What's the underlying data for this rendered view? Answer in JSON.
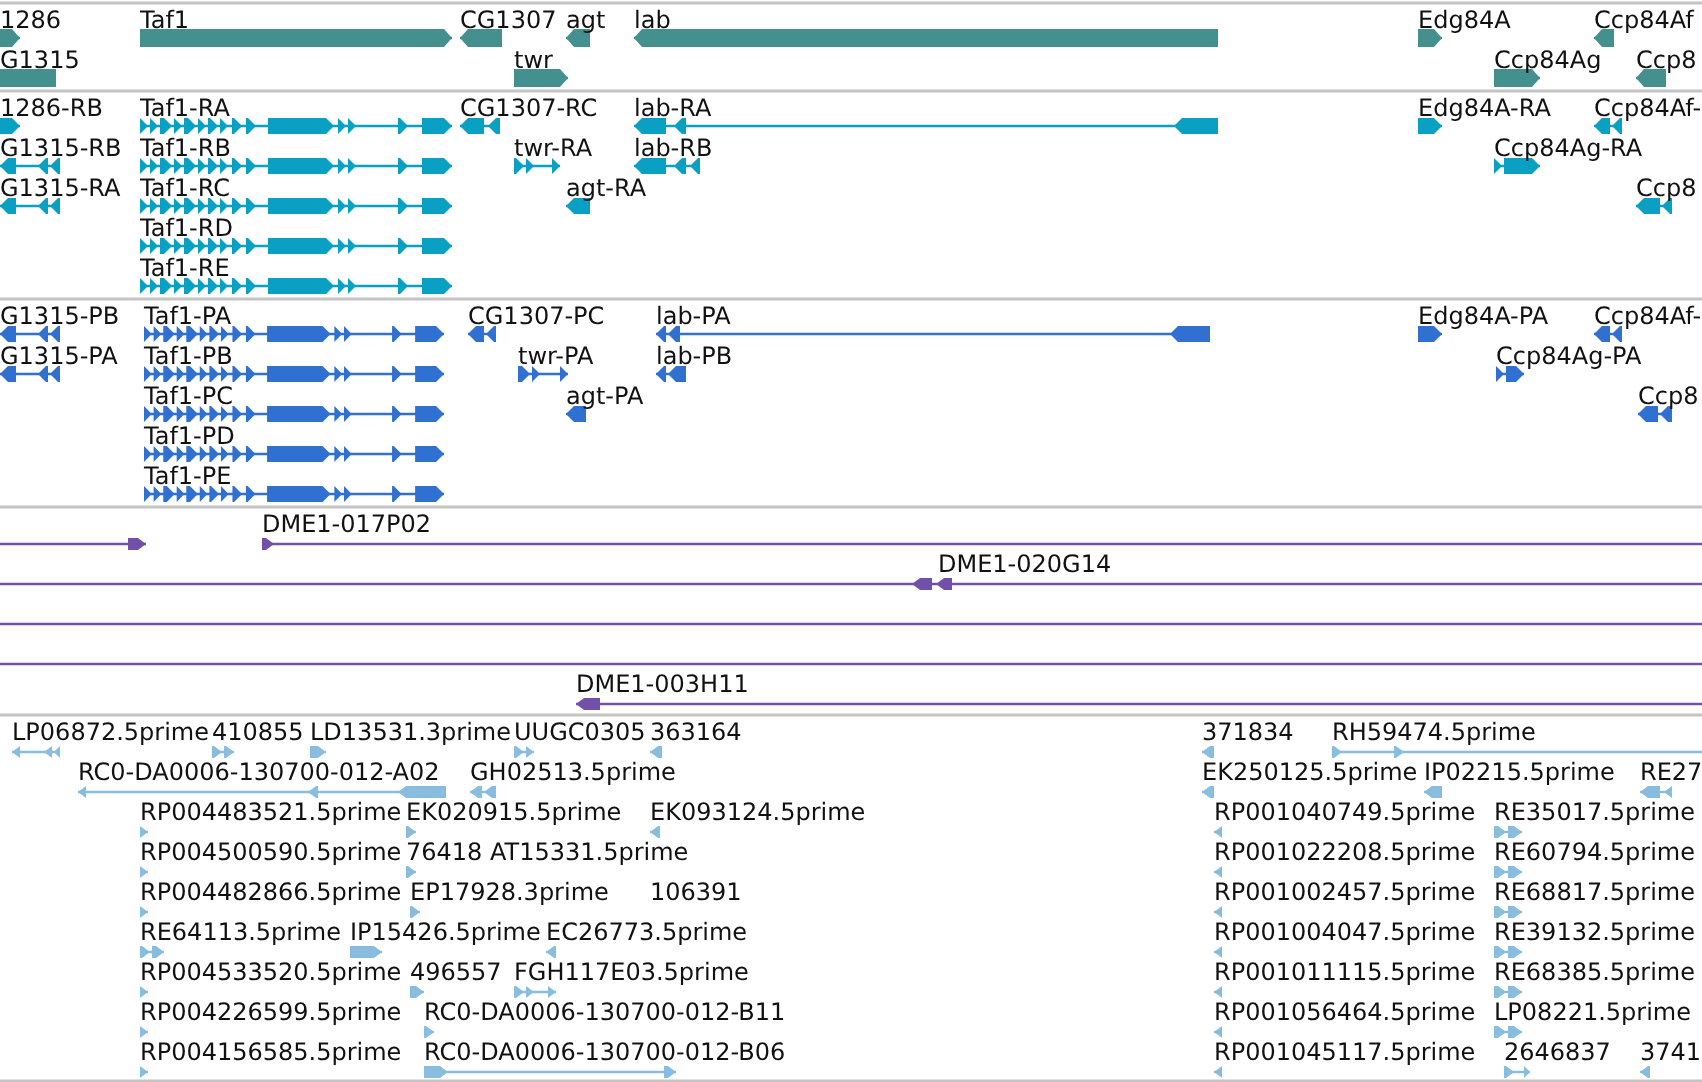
{
  "tracks": [
    {
      "kind": "gene",
      "color": "#44908f",
      "features": [
        {
          "label": "1286",
          "reverse": false
        },
        {
          "label": "Taf1",
          "reverse": false
        },
        {
          "label": "CG1307",
          "reverse": true
        },
        {
          "label": "agt",
          "reverse": true
        },
        {
          "label": "lab",
          "reverse": true
        },
        {
          "label": "Edg84A",
          "reverse": false
        },
        {
          "label": "Ccp84Af",
          "reverse": true
        },
        {
          "label": "G1315"
        },
        {
          "label": "twr",
          "reverse": false
        },
        {
          "label": "Ccp84Ag",
          "reverse": false
        },
        {
          "label": "Ccp8",
          "reverse": true
        }
      ]
    },
    {
      "kind": "transcript",
      "color": "#0aa0c4",
      "features": [
        {
          "label": "1286-RB",
          "reverse": false
        },
        {
          "label": "Taf1-RA",
          "reverse": false
        },
        {
          "label": "CG1307-RC",
          "reverse": true
        },
        {
          "label": "lab-RA",
          "reverse": true
        },
        {
          "label": "Edg84A-RA",
          "reverse": false
        },
        {
          "label": "Ccp84Af-",
          "reverse": true
        },
        {
          "label": "G1315-RB",
          "reverse": true
        },
        {
          "label": "Taf1-RB",
          "reverse": false
        },
        {
          "label": "twr-RA",
          "reverse": false
        },
        {
          "label": "lab-RB",
          "reverse": true
        },
        {
          "label": "Ccp84Ag-RA",
          "reverse": false
        },
        {
          "label": "G1315-RA",
          "reverse": true
        },
        {
          "label": "Taf1-RC",
          "reverse": false
        },
        {
          "label": "agt-RA",
          "reverse": true
        },
        {
          "label": "Ccp8",
          "reverse": true
        },
        {
          "label": "Taf1-RD",
          "reverse": false
        },
        {
          "label": "Taf1-RE",
          "reverse": false
        }
      ]
    },
    {
      "kind": "protein",
      "color": "#3070d0",
      "features": [
        {
          "label": "G1315-PB",
          "reverse": true
        },
        {
          "label": "Taf1-PA",
          "reverse": false
        },
        {
          "label": "CG1307-PC",
          "reverse": true
        },
        {
          "label": "lab-PA",
          "reverse": true
        },
        {
          "label": "Edg84A-PA",
          "reverse": false
        },
        {
          "label": "Ccp84Af-",
          "reverse": true
        },
        {
          "label": "G1315-PA",
          "reverse": true
        },
        {
          "label": "Taf1-PB",
          "reverse": false
        },
        {
          "label": "twr-PA",
          "reverse": false
        },
        {
          "label": "lab-PB",
          "reverse": true
        },
        {
          "label": "Ccp84Ag-PA",
          "reverse": false
        },
        {
          "label": "Taf1-PC",
          "reverse": false
        },
        {
          "label": "agt-PA",
          "reverse": true
        },
        {
          "label": "Ccp8",
          "reverse": true
        },
        {
          "label": "Taf1-PD",
          "reverse": false
        },
        {
          "label": "Taf1-PE",
          "reverse": false
        }
      ]
    },
    {
      "kind": "clone",
      "color": "#7050a8",
      "features": [
        {
          "kind": "arrow",
          "reverse": false
        },
        {
          "kind": "arrow",
          "label": "DME1-017P02",
          "reverse": false
        },
        {
          "kind": "arrow",
          "label": "DME1-020G14",
          "reverse": true
        },
        {
          "kind": "plain"
        },
        {
          "kind": "plain"
        },
        {
          "kind": "arrow",
          "label": "DME1-003H11",
          "reverse": true
        }
      ]
    },
    {
      "kind": "est",
      "color": "#88bde0",
      "features": [
        {
          "label": "LP06872.5prime",
          "reverse": true
        },
        {
          "label": "410855",
          "reverse": false
        },
        {
          "label": "LD13531.3prime",
          "reverse": false
        },
        {
          "label": "UUGC0305",
          "reverse": false
        },
        {
          "label": "363164",
          "reverse": true
        },
        {
          "label": "371834",
          "reverse": true
        },
        {
          "label": "RH59474.5prime",
          "reverse": false
        },
        {
          "label": "RC0-DA0006-130700-012-A02",
          "reverse": true
        },
        {
          "label": "GH02513.5prime",
          "reverse": true
        },
        {
          "label": "EK250125.5prime",
          "reverse": true
        },
        {
          "label": "IP02215.5prime",
          "reverse": true
        },
        {
          "label": "RE27",
          "reverse": true
        },
        {
          "label": "RP004483521.5prime",
          "reverse": false
        },
        {
          "label": "EK020915.5prime",
          "reverse": false
        },
        {
          "label": "EK093124.5prime",
          "reverse": true
        },
        {
          "label": "RP001040749.5prime",
          "reverse": true
        },
        {
          "label": "RE35017.5prime",
          "reverse": false
        },
        {
          "label": "RP004500590.5prime",
          "reverse": false
        },
        {
          "label": "76418",
          "reverse": false
        },
        {
          "label": "AT15331.5prime"
        },
        {
          "label": "RP001022208.5prime",
          "reverse": true
        },
        {
          "label": "RE60794.5prime",
          "reverse": false
        },
        {
          "label": "RP004482866.5prime",
          "reverse": false
        },
        {
          "label": "EP17928.3prime",
          "reverse": false
        },
        {
          "label": "106391"
        },
        {
          "label": "RP001002457.5prime",
          "reverse": true
        },
        {
          "label": "RE68817.5prime",
          "reverse": false
        },
        {
          "label": "RE64113.5prime",
          "reverse": false
        },
        {
          "label": "IP15426.5prime",
          "reverse": false
        },
        {
          "label": "EC26773.5prime",
          "reverse": true
        },
        {
          "label": "RP001004047.5prime",
          "reverse": true
        },
        {
          "label": "RE39132.5prime",
          "reverse": false
        },
        {
          "label": "RP004533520.5prime",
          "reverse": false
        },
        {
          "label": "496557",
          "reverse": false
        },
        {
          "label": "FGH117E03.5prime",
          "reverse": false
        },
        {
          "label": "RP001011115.5prime",
          "reverse": true
        },
        {
          "label": "RE68385.5prime",
          "reverse": false
        },
        {
          "label": "RP004226599.5prime",
          "reverse": false
        },
        {
          "label": "RC0-DA0006-130700-012-B11",
          "reverse": false
        },
        {
          "label": "RP001056464.5prime",
          "reverse": true
        },
        {
          "label": "LP08221.5prime",
          "reverse": false
        },
        {
          "label": "RP004156585.5prime",
          "reverse": false
        },
        {
          "label": "RC0-DA0006-130700-012-B06",
          "reverse": false
        },
        {
          "label": "RP001045117.5prime",
          "reverse": true
        },
        {
          "label": "2646837",
          "reverse": false
        },
        {
          "label": "3741",
          "reverse": true
        }
      ]
    }
  ]
}
